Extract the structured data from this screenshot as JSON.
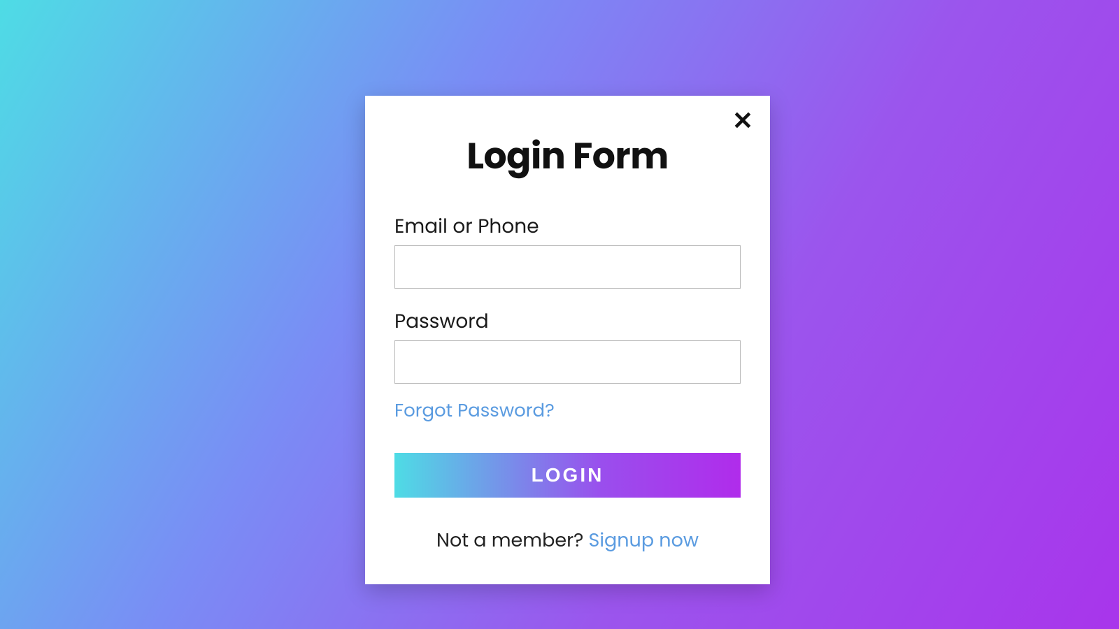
{
  "modal": {
    "title": "Login Form",
    "fields": {
      "email": {
        "label": "Email or Phone",
        "value": ""
      },
      "password": {
        "label": "Password",
        "value": ""
      }
    },
    "forgot_label": "Forgot Password?",
    "login_button": "LOGIN",
    "signup": {
      "prompt": "Not a member? ",
      "link": "Signup now"
    }
  }
}
